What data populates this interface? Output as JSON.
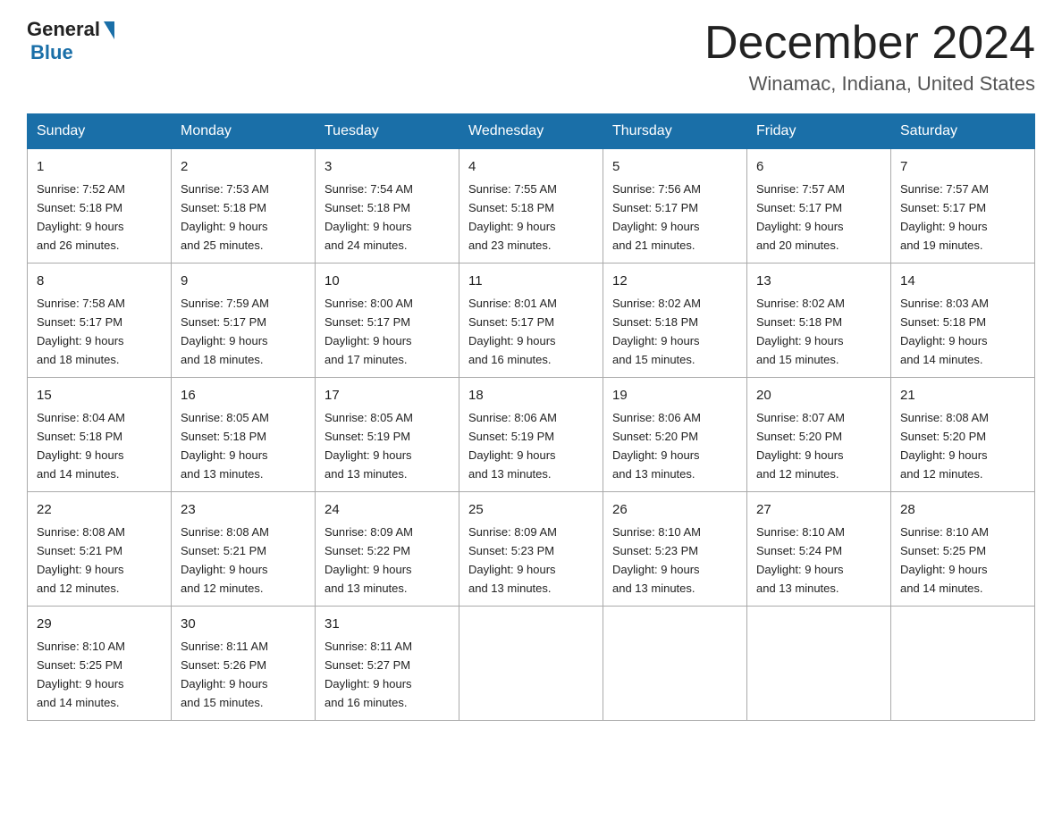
{
  "header": {
    "logo_general": "General",
    "logo_blue": "Blue",
    "month_title": "December 2024",
    "location": "Winamac, Indiana, United States"
  },
  "weekdays": [
    "Sunday",
    "Monday",
    "Tuesday",
    "Wednesday",
    "Thursday",
    "Friday",
    "Saturday"
  ],
  "weeks": [
    [
      {
        "day": "1",
        "sunrise": "7:52 AM",
        "sunset": "5:18 PM",
        "daylight": "9 hours and 26 minutes."
      },
      {
        "day": "2",
        "sunrise": "7:53 AM",
        "sunset": "5:18 PM",
        "daylight": "9 hours and 25 minutes."
      },
      {
        "day": "3",
        "sunrise": "7:54 AM",
        "sunset": "5:18 PM",
        "daylight": "9 hours and 24 minutes."
      },
      {
        "day": "4",
        "sunrise": "7:55 AM",
        "sunset": "5:18 PM",
        "daylight": "9 hours and 23 minutes."
      },
      {
        "day": "5",
        "sunrise": "7:56 AM",
        "sunset": "5:17 PM",
        "daylight": "9 hours and 21 minutes."
      },
      {
        "day": "6",
        "sunrise": "7:57 AM",
        "sunset": "5:17 PM",
        "daylight": "9 hours and 20 minutes."
      },
      {
        "day": "7",
        "sunrise": "7:57 AM",
        "sunset": "5:17 PM",
        "daylight": "9 hours and 19 minutes."
      }
    ],
    [
      {
        "day": "8",
        "sunrise": "7:58 AM",
        "sunset": "5:17 PM",
        "daylight": "9 hours and 18 minutes."
      },
      {
        "day": "9",
        "sunrise": "7:59 AM",
        "sunset": "5:17 PM",
        "daylight": "9 hours and 18 minutes."
      },
      {
        "day": "10",
        "sunrise": "8:00 AM",
        "sunset": "5:17 PM",
        "daylight": "9 hours and 17 minutes."
      },
      {
        "day": "11",
        "sunrise": "8:01 AM",
        "sunset": "5:17 PM",
        "daylight": "9 hours and 16 minutes."
      },
      {
        "day": "12",
        "sunrise": "8:02 AM",
        "sunset": "5:18 PM",
        "daylight": "9 hours and 15 minutes."
      },
      {
        "day": "13",
        "sunrise": "8:02 AM",
        "sunset": "5:18 PM",
        "daylight": "9 hours and 15 minutes."
      },
      {
        "day": "14",
        "sunrise": "8:03 AM",
        "sunset": "5:18 PM",
        "daylight": "9 hours and 14 minutes."
      }
    ],
    [
      {
        "day": "15",
        "sunrise": "8:04 AM",
        "sunset": "5:18 PM",
        "daylight": "9 hours and 14 minutes."
      },
      {
        "day": "16",
        "sunrise": "8:05 AM",
        "sunset": "5:18 PM",
        "daylight": "9 hours and 13 minutes."
      },
      {
        "day": "17",
        "sunrise": "8:05 AM",
        "sunset": "5:19 PM",
        "daylight": "9 hours and 13 minutes."
      },
      {
        "day": "18",
        "sunrise": "8:06 AM",
        "sunset": "5:19 PM",
        "daylight": "9 hours and 13 minutes."
      },
      {
        "day": "19",
        "sunrise": "8:06 AM",
        "sunset": "5:20 PM",
        "daylight": "9 hours and 13 minutes."
      },
      {
        "day": "20",
        "sunrise": "8:07 AM",
        "sunset": "5:20 PM",
        "daylight": "9 hours and 12 minutes."
      },
      {
        "day": "21",
        "sunrise": "8:08 AM",
        "sunset": "5:20 PM",
        "daylight": "9 hours and 12 minutes."
      }
    ],
    [
      {
        "day": "22",
        "sunrise": "8:08 AM",
        "sunset": "5:21 PM",
        "daylight": "9 hours and 12 minutes."
      },
      {
        "day": "23",
        "sunrise": "8:08 AM",
        "sunset": "5:21 PM",
        "daylight": "9 hours and 12 minutes."
      },
      {
        "day": "24",
        "sunrise": "8:09 AM",
        "sunset": "5:22 PM",
        "daylight": "9 hours and 13 minutes."
      },
      {
        "day": "25",
        "sunrise": "8:09 AM",
        "sunset": "5:23 PM",
        "daylight": "9 hours and 13 minutes."
      },
      {
        "day": "26",
        "sunrise": "8:10 AM",
        "sunset": "5:23 PM",
        "daylight": "9 hours and 13 minutes."
      },
      {
        "day": "27",
        "sunrise": "8:10 AM",
        "sunset": "5:24 PM",
        "daylight": "9 hours and 13 minutes."
      },
      {
        "day": "28",
        "sunrise": "8:10 AM",
        "sunset": "5:25 PM",
        "daylight": "9 hours and 14 minutes."
      }
    ],
    [
      {
        "day": "29",
        "sunrise": "8:10 AM",
        "sunset": "5:25 PM",
        "daylight": "9 hours and 14 minutes."
      },
      {
        "day": "30",
        "sunrise": "8:11 AM",
        "sunset": "5:26 PM",
        "daylight": "9 hours and 15 minutes."
      },
      {
        "day": "31",
        "sunrise": "8:11 AM",
        "sunset": "5:27 PM",
        "daylight": "9 hours and 16 minutes."
      },
      null,
      null,
      null,
      null
    ]
  ]
}
